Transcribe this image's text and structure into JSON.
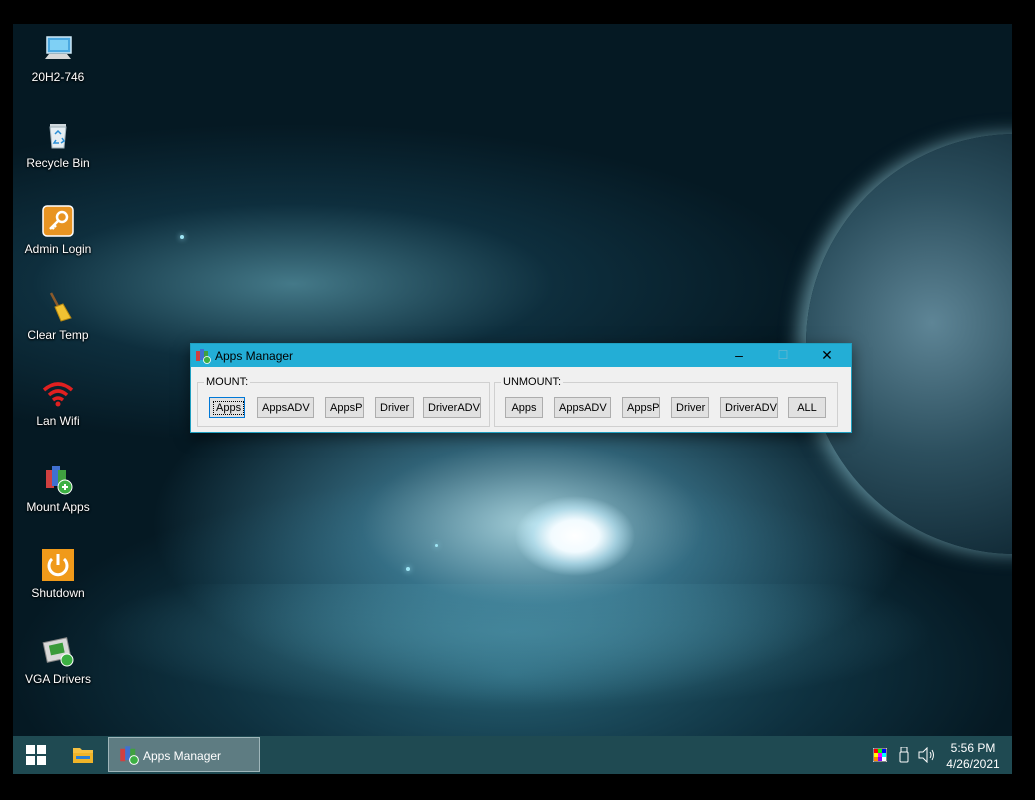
{
  "desktop": {
    "icons": [
      {
        "label": "20H2-746",
        "icon": "computer-icon"
      },
      {
        "label": "Recycle Bin",
        "icon": "recycle-bin-icon"
      },
      {
        "label": "Admin Login",
        "icon": "key-icon"
      },
      {
        "label": "Clear Temp",
        "icon": "broom-icon"
      },
      {
        "label": "Lan Wifi",
        "icon": "wifi-icon"
      },
      {
        "label": "Mount Apps",
        "icon": "mount-apps-icon"
      },
      {
        "label": "Shutdown",
        "icon": "power-icon"
      },
      {
        "label": "VGA Drivers",
        "icon": "vga-drivers-icon"
      }
    ]
  },
  "window": {
    "title": "Apps Manager",
    "controls": {
      "minimize": "–",
      "maximize": "☐",
      "close": "✕"
    },
    "mount": {
      "label": "MOUNT:",
      "buttons": [
        "Apps",
        "AppsADV",
        "AppsP",
        "Driver",
        "DriverADV"
      ]
    },
    "unmount": {
      "label": "UNMOUNT:",
      "buttons": [
        "Apps",
        "AppsADV",
        "AppsP",
        "Driver",
        "DriverADV",
        "ALL"
      ]
    }
  },
  "taskbar": {
    "app_label": "Apps Manager",
    "time": "5:56 PM",
    "date": "4/26/2021"
  },
  "colors": {
    "titlebar": "#23aed6",
    "taskbar": "#1f4a52",
    "start": "#ffffff"
  }
}
